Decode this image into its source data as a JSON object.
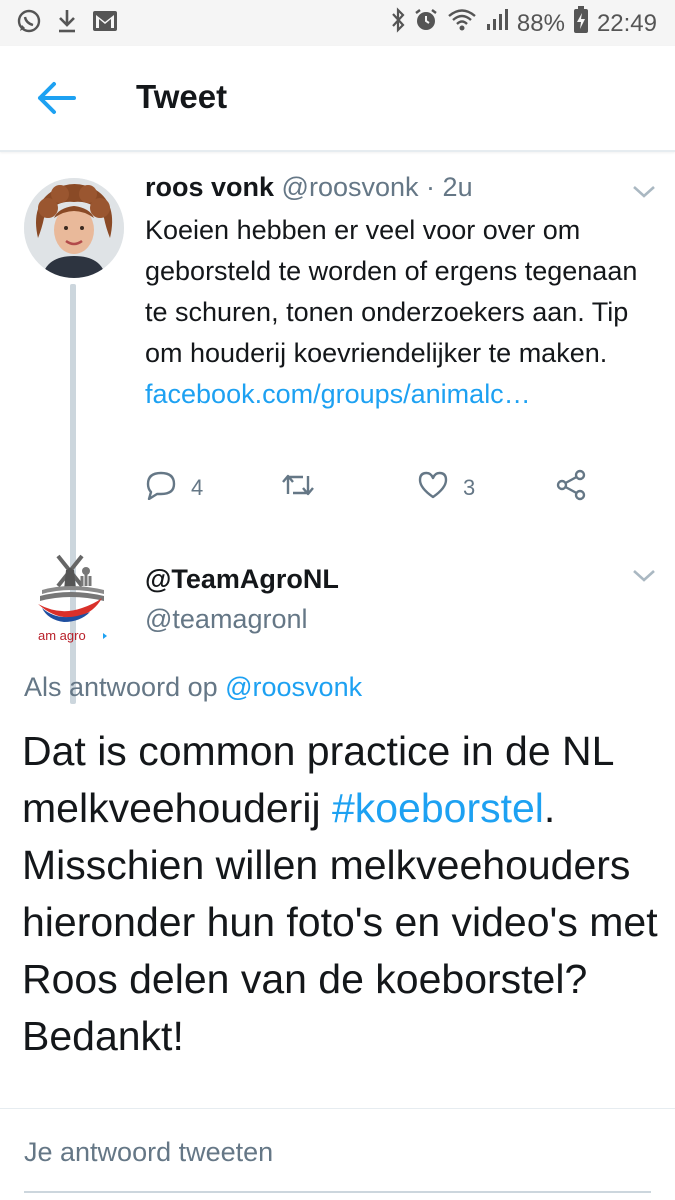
{
  "status_bar": {
    "battery": "88%",
    "time": "22:49"
  },
  "header": {
    "title": "Tweet"
  },
  "tweet": {
    "author_name": "roos vonk",
    "author_handle": "@roosvonk",
    "separator": "·",
    "time_ago": "2u",
    "text": "Koeien hebben er veel voor over om geborsteld te worden of ergens tegenaan te schuren, tonen onderzoekers aan. Tip om houderij koevriendelijker te maken.",
    "link": "facebook.com/groups/animalc…",
    "reply_count": "4",
    "like_count": "3"
  },
  "reply": {
    "avatar_logo_text": "am agro",
    "author_name": "@TeamAgroNL",
    "author_handle": "@teamagronl",
    "replying_prefix": "Als antwoord op ",
    "replying_to": "@roosvonk",
    "text_part1": "Dat is common practice in de NL melkveehouderij ",
    "hashtag": "#koeborstel",
    "text_part2": ". Misschien willen melkveehouders hieronder hun foto's en video's met Roos delen van de koeborstel? Bedankt!"
  },
  "composer": {
    "placeholder": "Je antwoord tweeten"
  },
  "colors": {
    "accent": "#1da1f2",
    "text_primary": "#14171a",
    "text_secondary": "#657786",
    "divider": "#e6ecf0"
  }
}
